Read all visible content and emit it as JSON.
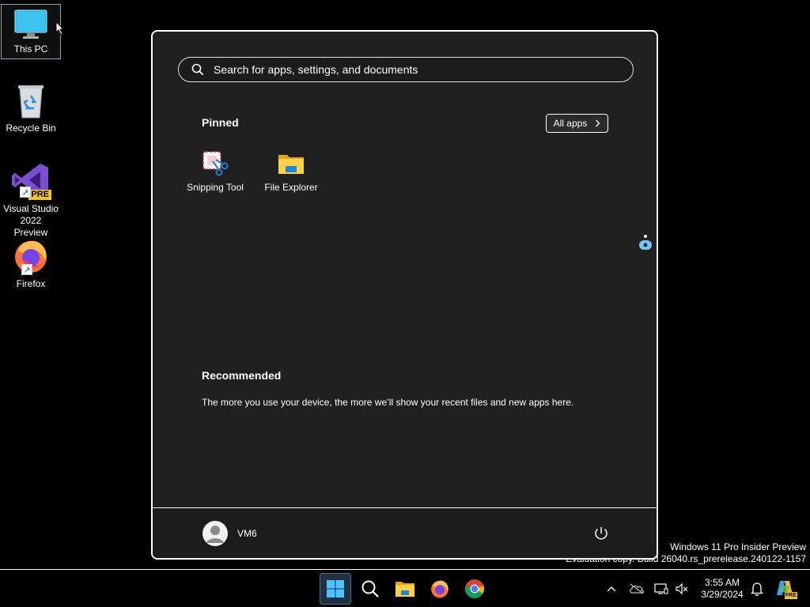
{
  "desktop": {
    "icons": [
      {
        "label": "This PC",
        "icon": "monitor-icon"
      },
      {
        "label": "Recycle Bin",
        "icon": "recycle-bin-icon"
      },
      {
        "label": "Visual Studio 2022 Preview",
        "icon": "visual-studio-icon",
        "badge": "PRE"
      },
      {
        "label": "Firefox",
        "icon": "firefox-icon"
      }
    ],
    "watermark": {
      "line1": "Windows 11 Pro Insider Preview",
      "line2": "Evaluation copy. Build 26040.rs_prerelease.240122-1157"
    }
  },
  "start_menu": {
    "search_placeholder": "Search for apps, settings, and documents",
    "pinned_title": "Pinned",
    "all_apps_label": "All apps",
    "pinned_apps": [
      {
        "label": "Snipping Tool",
        "icon": "snipping-tool-icon"
      },
      {
        "label": "File Explorer",
        "icon": "file-explorer-icon"
      }
    ],
    "recommended_title": "Recommended",
    "recommended_text": "The more you use your device, the more we’ll show your recent files and new apps here.",
    "user_name": "VM6"
  },
  "taskbar": {
    "apps": [
      "start-icon",
      "search-icon",
      "file-explorer-icon",
      "firefox-icon",
      "chrome-icon"
    ],
    "clock": {
      "time": "3:55 AM",
      "date": "3/29/2024"
    },
    "tray_badge": "PRE"
  },
  "colors": {
    "start_bg": "#202020",
    "accent": "#0078d4",
    "desktop_bg": "#000000"
  }
}
